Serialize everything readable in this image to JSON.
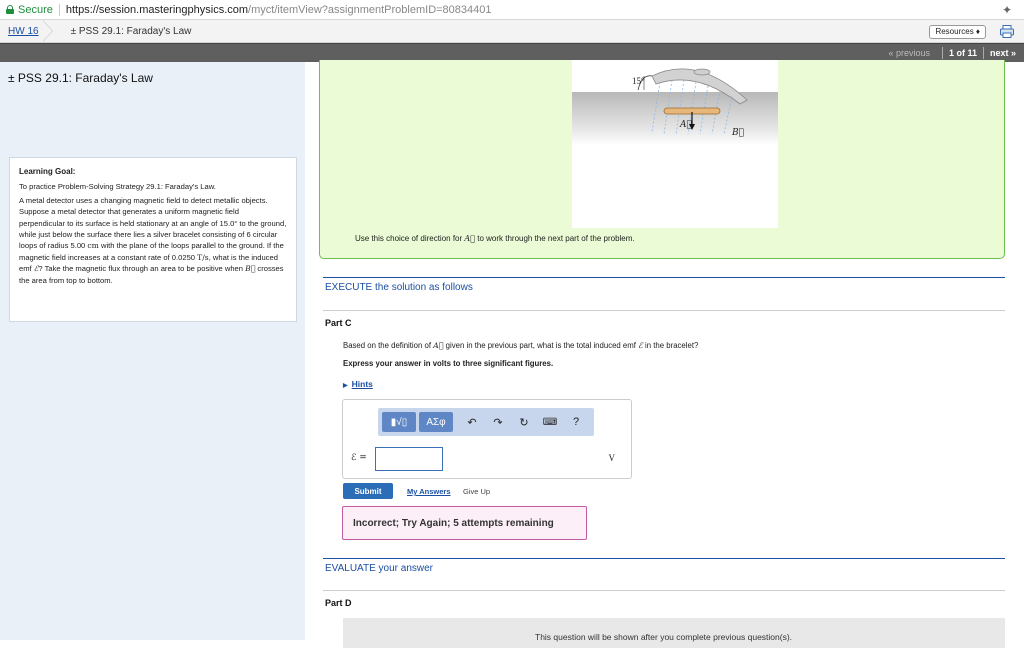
{
  "browser": {
    "secure_label": "Secure",
    "url_main": "https://session.masteringphysics.com",
    "url_rest": "/myct/itemView?assignmentProblemID=80834401"
  },
  "breadcrumb": {
    "hw_label": "HW 16",
    "problem_title": "± PSS 29.1: Faraday's Law",
    "resources_label": "Resources ♦"
  },
  "nav": {
    "previous_label": "« previous",
    "count_label": "1 of 11",
    "next_label": "next »"
  },
  "sidebar": {
    "title": "± PSS 29.1: Faraday's Law",
    "goal_heading": "Learning Goal:",
    "goal_text": "To practice Problem-Solving Strategy 29.1: Faraday's Law.",
    "body_1": "A metal detector uses a changing magnetic field to detect metallic objects. Suppose a metal detector that generates a uniform magnetic field perpendicular to its surface is held stationary at an angle of 15.0° to the ground, while just below the surface there lies a silver bracelet consisting of 6 circular loops of radius 5.00",
    "unit_cm": "cm",
    "body_2": "with the plane of the loops parallel to the ground. If the magnetic field increases at a constant rate of 0.0250",
    "unit_ts": "T/s",
    "body_3": ", what is the induced emf",
    "sym_emf": "ℰ",
    "body_4": "? Take the magnetic flux through an area to be positive when",
    "sym_b": "B⃗",
    "body_5": "crosses the area from top to bottom."
  },
  "figure": {
    "angle_label": "15°",
    "a_label": "A⃗",
    "b_label": "B⃗"
  },
  "direction_note": {
    "text_1": "Use this choice of direction for",
    "sym": "A⃗",
    "text_2": "to work through the next part of the problem."
  },
  "execute": {
    "heading": "EXECUTE the solution as follows"
  },
  "part_c": {
    "label": "Part C",
    "q_1": "Based on the definition of",
    "sym_a": "A⃗",
    "q_2": "given in the previous part, what is the total induced emf",
    "sym_emf": "ℰ",
    "q_3": "in the bracelet?",
    "instruction": "Express your answer in volts to three significant figures.",
    "hints_label": "Hints",
    "emf_label": "ℰ =",
    "unit": "V",
    "input_value": "",
    "toolbar": {
      "template_label": "▮√▯",
      "greek_label": "ΑΣφ",
      "undo": "↶",
      "redo": "↷",
      "reset": "↻",
      "keyboard": "⌨",
      "help": "?"
    },
    "submit_label": "Submit",
    "my_answers_label": "My Answers",
    "give_up_label": "Give Up",
    "feedback": "Incorrect; Try Again; 5 attempts remaining"
  },
  "evaluate": {
    "heading": "EVALUATE your answer"
  },
  "part_d": {
    "label": "Part D",
    "locked_text": "This question will be shown after you complete previous question(s)."
  }
}
